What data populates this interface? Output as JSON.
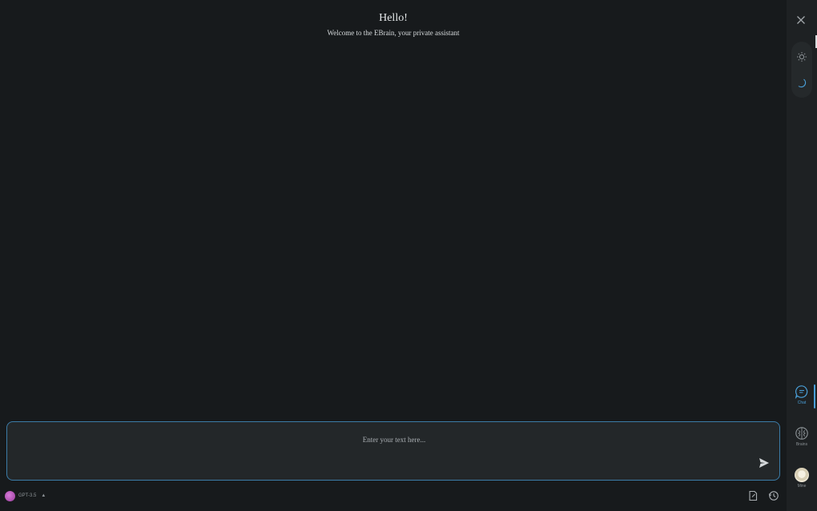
{
  "greeting": {
    "title": "Hello!",
    "subtitle": "Welcome to the EBrain, your private assistant"
  },
  "composer": {
    "placeholder": "Enter your text here..."
  },
  "bottom_bar": {
    "model_label": "GPT-3.5",
    "model_icon": "openai-icon"
  },
  "rail": {
    "items": [
      {
        "label": "Chat",
        "icon": "chat-bubble-icon",
        "active": true
      },
      {
        "label": "Brains",
        "icon": "brain-icon",
        "active": false
      },
      {
        "label": "Mine",
        "icon": "avatar",
        "active": false
      }
    ],
    "theme": [
      "light",
      "dark"
    ]
  },
  "colors": {
    "background": "#171a1c",
    "rail": "#1e2123",
    "accent": "#4a9fd8",
    "composer_border": "#3c7ca8"
  }
}
